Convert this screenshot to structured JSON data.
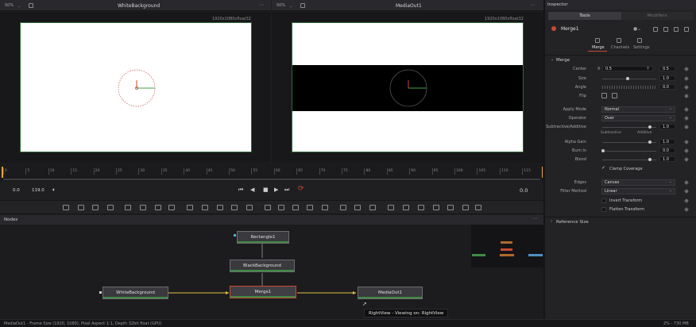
{
  "left_viewer": {
    "zoom": "50%",
    "title": "WhiteBackground",
    "resolution": "1920x1080xfloat32"
  },
  "right_viewer": {
    "zoom": "50%",
    "title": "MediaOut1",
    "resolution": "1920x1080xfloat32"
  },
  "ruler_ticks": [
    "0",
    "5",
    "10",
    "15",
    "20",
    "25",
    "30",
    "35",
    "40",
    "45",
    "50",
    "55",
    "60",
    "65",
    "70",
    "75",
    "80",
    "85",
    "90",
    "95",
    "100",
    "105",
    "110",
    "115"
  ],
  "transport": {
    "current_frame": "0.0",
    "end_frame": "119.0",
    "timecode": "0.0"
  },
  "nodes_panel": {
    "title": "Nodes",
    "nodes": {
      "rectangle": "Rectangle1",
      "black_bg": "BlackBackground",
      "white_bg": "WhiteBackground",
      "merge": "Merge1",
      "media_out": "MediaOut1"
    },
    "tooltip": "RightView - Viewing on: RightView"
  },
  "status_bar": {
    "left": "MediaOut1 - Frame Size (1920, 1080), Pixel Aspect 1:1, Depth 32bit float (GPU)",
    "right": "2% - 730 MB"
  },
  "inspector": {
    "title": "Inspector",
    "tabs": [
      "Tools",
      "Modifiers"
    ],
    "node_name": "Merge1",
    "subtabs": [
      "Merge",
      "Channels",
      "Settings"
    ],
    "section": "Merge",
    "center": {
      "label": "Center",
      "x_label": "X",
      "x": "0.5",
      "y_label": "Y",
      "y": "0.5"
    },
    "size": {
      "label": "Size",
      "value": "1.0"
    },
    "angle": {
      "label": "Angle",
      "value": "0.0"
    },
    "flip": {
      "label": "Flip"
    },
    "apply_mode": {
      "label": "Apply Mode",
      "value": "Normal"
    },
    "operator": {
      "label": "Operator",
      "value": "Over"
    },
    "subtractive_additive": {
      "label": "Subtractive/Additive",
      "value": "1.0",
      "left": "Subtractive",
      "right": "Additive"
    },
    "alpha_gain": {
      "label": "Alpha Gain",
      "value": "1.0"
    },
    "burn_in": {
      "label": "Burn In",
      "value": "0.0"
    },
    "blend": {
      "label": "Blend",
      "value": "1.0"
    },
    "clamp": "Clamp Coverage",
    "edges": {
      "label": "Edges",
      "value": "Canvas"
    },
    "filter_method": {
      "label": "Filter Method",
      "value": "Linear"
    },
    "invert_transform": "Invert Transform",
    "flatten_transform": "Flatten Transform",
    "reference_size": "Reference Size"
  },
  "colors": {
    "accent_orange": "#e8a23a",
    "green": "#3f8b45",
    "red": "#c9482f",
    "selected_node_border": "#c9482f"
  }
}
